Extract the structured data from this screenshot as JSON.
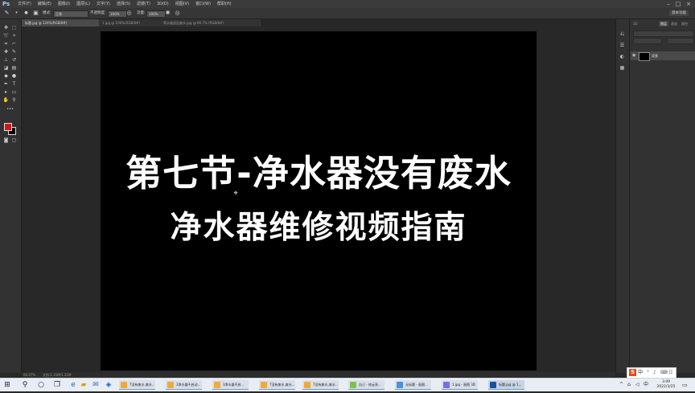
{
  "menubar": {
    "app_icon": "Ps",
    "items": [
      "文件(F)",
      "编辑(E)",
      "图像(I)",
      "图层(L)",
      "文字(Y)",
      "选择(S)",
      "滤镜(T)",
      "3D(D)",
      "视图(V)",
      "窗口(W)",
      "帮助(H)"
    ]
  },
  "options": {
    "mode_label": "模式:",
    "mode_value": "正常",
    "opacity_label": "不透明度:",
    "opacity_value": "100%",
    "flow_label": "流量:",
    "flow_value": "100%",
    "workspace": "基本功能"
  },
  "tabs": [
    {
      "label": "标题.jpg @ 124%(RGB/8#)",
      "active": true
    },
    {
      "label": "1.jpg @ 100%(RGB/8#)",
      "active": false
    },
    {
      "label": "等水器因没废水.jpg @ 66.7% (RGB/8#)",
      "active": false
    }
  ],
  "canvas": {
    "line1": "第七节-净水器没有废水",
    "line2": "净水器维修视频指南"
  },
  "statusbar": {
    "zoom": "66.67%",
    "doc": "文档:1.31M/1.31M"
  },
  "layers_panel": {
    "tabs": [
      "图层",
      "通道",
      "路径"
    ],
    "layer_name": "背景"
  },
  "taskbar": {
    "windows": [
      {
        "label": "7没有废水,废水...",
        "color": "#f2a93b"
      },
      {
        "label": "3净水器不启动...",
        "color": "#f2a93b"
      },
      {
        "label": "3净水器不启...",
        "color": "#f2a93b"
      },
      {
        "label": "7没有废水,废水...",
        "color": "#f2a93b"
      },
      {
        "label": "7没有废水,废水...",
        "color": "#f2a93b"
      },
      {
        "label": "自己 - 校云亮...",
        "color": "#7ec24a"
      },
      {
        "label": "无标题 - 画图...",
        "color": "#4a90e2"
      },
      {
        "label": "1.jpg - 画图 3D",
        "color": "#7a6ee6"
      },
      {
        "label": "标题.jpg @ 1...",
        "color": "#1a4fa0"
      }
    ],
    "ime": "中",
    "time": "3:09",
    "date": "2022/3/25"
  }
}
